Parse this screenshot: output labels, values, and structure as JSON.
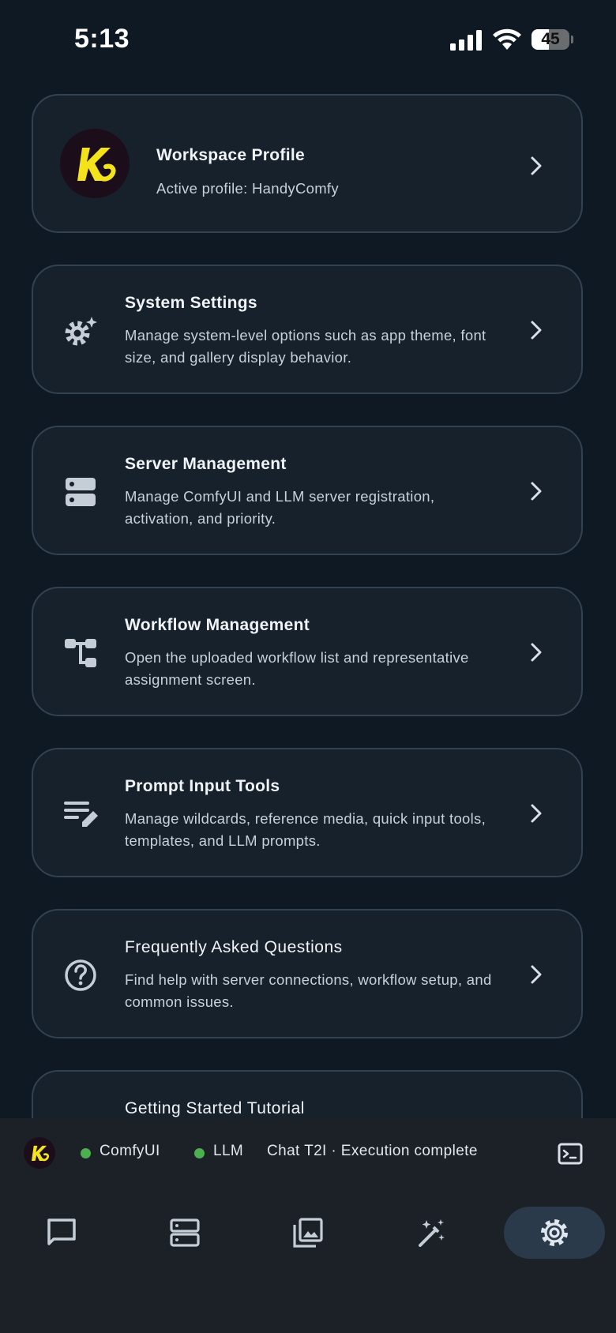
{
  "status_bar": {
    "time": "5:13",
    "battery": "45",
    "battery_level": 0.45
  },
  "cards": [
    {
      "title": "Workspace Profile",
      "description": "Active profile: HandyComfy",
      "icon": "workspace-avatar"
    },
    {
      "title": "System Settings",
      "description": "Manage system-level options such as app theme, font size, and gallery display behavior.",
      "icon": "settings-sparkle-icon"
    },
    {
      "title": "Server Management",
      "description": "Manage ComfyUI and LLM server registration, activation, and priority.",
      "icon": "server-icon"
    },
    {
      "title": "Workflow Management",
      "description": "Open the uploaded workflow list and representative assignment screen.",
      "icon": "workflow-tree-icon"
    },
    {
      "title": "Prompt Input Tools",
      "description": "Manage wildcards, reference media, quick input tools, templates, and LLM prompts.",
      "icon": "edit-note-icon"
    },
    {
      "title": "Frequently Asked Questions",
      "description": "Find help with server connections, workflow setup, and common issues.",
      "icon": "help-circle-icon"
    },
    {
      "title": "Getting Started Tutorial",
      "description": "",
      "icon": ""
    }
  ],
  "connection_bar": {
    "comfyui_label": "ComfyUI",
    "llm_label": "LLM",
    "status_text": "Chat T2I · Execution complete",
    "status_color": "#4caf50"
  },
  "nav": {
    "items": [
      "chat-icon",
      "server-icon",
      "gallery-icon",
      "magic-wand-icon",
      "settings-icon"
    ],
    "active": "settings-icon"
  }
}
